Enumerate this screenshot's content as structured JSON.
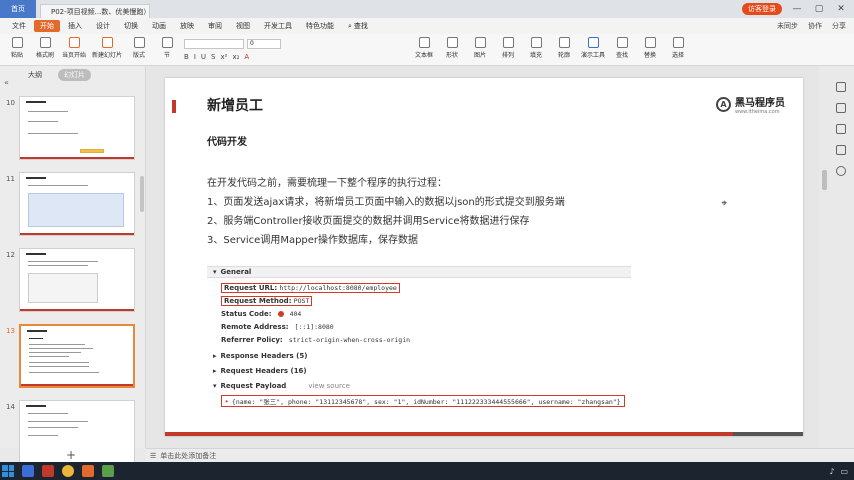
{
  "titlebar": {
    "home_tab": "首页",
    "doc_tab": "P02-项目视频...数、优美慢跑）",
    "login": "访客登录",
    "controls": [
      "—",
      "▢",
      "✕"
    ]
  },
  "menu": {
    "file": "文件",
    "items": [
      "开始",
      "插入",
      "设计",
      "切换",
      "动画",
      "放映",
      "审阅",
      "视图",
      "开发工具",
      "特色功能"
    ],
    "active": "开始",
    "search": "查找",
    "right": [
      "未同步",
      "协作",
      "分享"
    ]
  },
  "ribbon": {
    "paste": "粘贴",
    "format_painter": "格式刷",
    "from_current": "当页开始",
    "new_slide": "新建幻灯片",
    "layout": "版式",
    "section": "节",
    "font_size": "0",
    "textbox": "文本框",
    "shape": "形状",
    "arrange": "排列",
    "outline": "轮廓",
    "presentation_tools": "演示工具",
    "find": "查找",
    "replace": "替换",
    "select": "选择",
    "picture": "图片",
    "fill": "填充",
    "format_buttons": [
      "B",
      "I",
      "U",
      "S",
      "x²",
      "x₂",
      "A"
    ]
  },
  "left_panel": {
    "tab_outline": "大纲",
    "tab_slides": "幻灯片",
    "slide_numbers": [
      "10",
      "11",
      "12",
      "13",
      "14"
    ],
    "active_index": 3
  },
  "slide": {
    "title": "新增员工",
    "logo_name": "黑马程序员",
    "logo_sub": "www.itheima.com",
    "subtitle": "代码开发",
    "intro": "在开发代码之前，需要梳理一下整个程序的执行过程：",
    "steps": [
      "1、页面发送ajax请求，将新增员工页面中输入的数据以json的形式提交到服务端",
      "2、服务端Controller接收页面提交的数据并调用Service将数据进行保存",
      "3、Service调用Mapper操作数据库，保存数据"
    ]
  },
  "devtools": {
    "general": "General",
    "request_url_label": "Request URL:",
    "request_url": "http://localhost:8080/employee",
    "request_method_label": "Request Method:",
    "request_method": "POST",
    "status_code_label": "Status Code:",
    "status_code": "404",
    "remote_address_label": "Remote Address:",
    "remote_address": "[::1]:8080",
    "referrer_policy_label": "Referrer Policy:",
    "referrer_policy": "strict-origin-when-cross-origin",
    "response_headers": "Response Headers (5)",
    "request_headers": "Request Headers (16)",
    "request_payload": "Request Payload",
    "view_source": "view source",
    "payload": "{name: \"张三\", phone: \"13112345678\", sex: \"1\", idNumber: \"111222333444555666\", username: \"zhangsan\"}"
  },
  "notes": {
    "placeholder": "单击此处添加备注"
  },
  "colors": {
    "accent_orange": "#e26a2c",
    "brand_red": "#c0392b",
    "highlight_box": "#d43a2a",
    "home_tab_blue": "#4a78c8"
  }
}
